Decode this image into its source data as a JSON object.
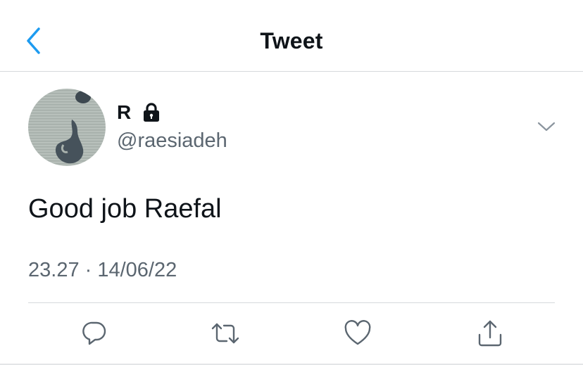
{
  "nav": {
    "title": "Tweet"
  },
  "tweet": {
    "author_name": "R",
    "author_handle": "@raesiadeh",
    "text": "Good job Raefal",
    "timestamp": "23.27 · 14/06/22"
  },
  "colors": {
    "accent": "#1d9bf0",
    "icon_gray": "#5b6670",
    "divider": "#d6d9dc"
  },
  "icons": {
    "back": "chevron-left-icon",
    "protected": "lock-icon",
    "more": "chevron-down-icon",
    "reply": "reply-icon",
    "retweet": "retweet-icon",
    "like": "heart-icon",
    "share": "share-icon"
  }
}
